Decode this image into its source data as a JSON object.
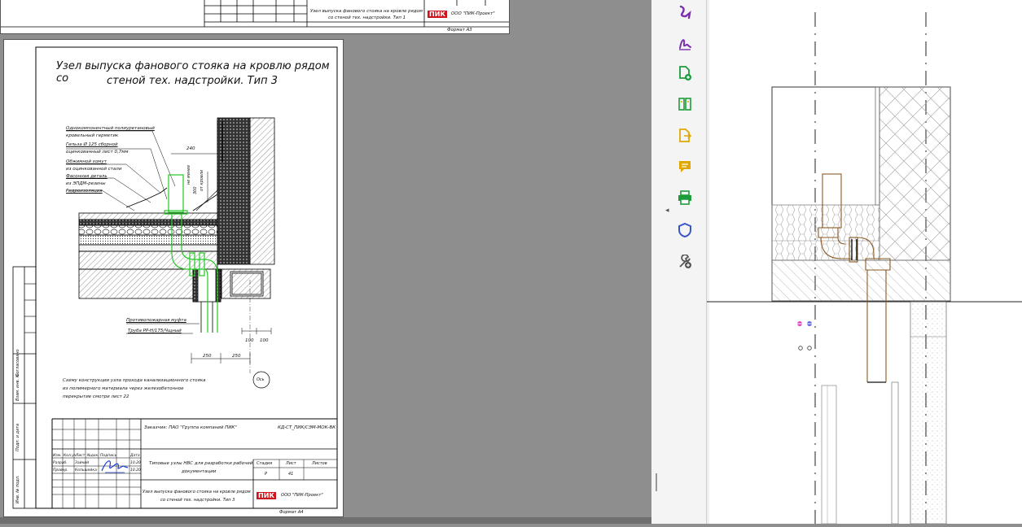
{
  "top_sheet": {
    "title_line1": "Узел выпуска фанового стояка на кровле рядом",
    "title_line2": "со стеной тех. надстройки. Тип 1",
    "company": "ООО \"ПИК-Проект\"",
    "logo": "ПИК",
    "format": "Формат А3"
  },
  "main_sheet": {
    "title_line1": "Узел выпуска фанового стояка на кровлю рядом со",
    "title_line2": "стеной тех. надстройки. Тип 3",
    "callouts": [
      "Однокомпонентный полиуретановый",
      "кровельный герметик",
      "Гильза Ø 125 сборной",
      "оцинкованный лист 0,7мм",
      "Обжимной хомут",
      "из оцинкованной стали",
      "Фасонная деталь",
      "из ЭПДМ-резины",
      "Гидроизоляция"
    ],
    "dim_top": "240",
    "dim_side1": "не менее",
    "dim_side2": "300",
    "dim_side3": "от кровли",
    "callout_sleeve": "Противопожарная муфта",
    "callout_pipe": "Труба PP-H/175/Чщный",
    "dims_right": [
      "100",
      "100"
    ],
    "dims_bottom": [
      "250",
      "250"
    ],
    "axis": "Ось",
    "note_line1": "Схему конструкции узла прохода канализационного стояка",
    "note_line2": "из полимерного материала через железобетонное",
    "note_line3": "перекрытие смотри лист 22",
    "customer": "Заказчик: ПАО \"Группа компаний ПИК\"",
    "code": "КД-СТ_ПИК/СЭМ-МОК-ВК",
    "side_labels": [
      "Согласовано",
      "Взам. инв. №",
      "Подп. и дата",
      "Инв. № подл."
    ],
    "tb_headers": [
      "Изм.",
      "Кол.уч",
      "Лист",
      "№док.",
      "Подпись",
      "Дата"
    ],
    "row_roles": [
      "Разраб.",
      "Провер."
    ],
    "row_names": [
      "Зайкий",
      "Копьшейка"
    ],
    "row_dates": [
      "10.20",
      "10.20"
    ],
    "doc_name_line1": "Типовые узлы НВС для разработки рабочей",
    "doc_name_line2": "документации",
    "stage_hdr": [
      "Стадия",
      "Лист",
      "Листов"
    ],
    "stage_vals": [
      "Р",
      "41",
      ""
    ],
    "sheet_title1": "Узел выпуска фанового стояка на кровле рядом",
    "sheet_title2": "со стеной тех. надстройки. Тип 3",
    "logo": "ПИК",
    "company": "ООО \"ПИК-Проект\"",
    "format": "Формат А4"
  },
  "toolbar": {
    "tools": [
      "fill-sign-icon",
      "request-signature-icon",
      "create-pdf-icon",
      "organize-pages-icon",
      "export-pdf-icon",
      "comment-icon",
      "print-production-icon",
      "protect-icon",
      "more-tools-icon"
    ],
    "collapse_glyph": "◂"
  },
  "colors": {
    "green": "#22c822",
    "brown": "#8a5a22",
    "adobe_purple": "#7b2fb0",
    "adobe_green": "#1e9c3a",
    "adobe_yellow": "#e0a800",
    "adobe_blue": "#3a55c9",
    "logo_red": "#d0131b"
  }
}
